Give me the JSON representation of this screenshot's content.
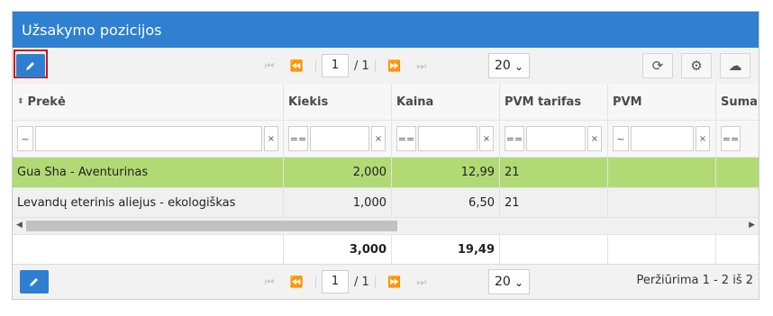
{
  "panel": {
    "title": "Užsakymo pozicijos"
  },
  "toolbar": {
    "edit_icon": "pencil-icon",
    "page_current": "1",
    "page_total": "/ 1",
    "page_size": "20",
    "refresh_icon": "refresh-icon",
    "settings_icon": "gear-icon",
    "download_icon": "cloud-download-icon"
  },
  "columns": [
    {
      "label": "Prekė",
      "sort_icon": "sort-icon"
    },
    {
      "label": "Kiekis"
    },
    {
      "label": "Kaina"
    },
    {
      "label": "PVM tarifas"
    },
    {
      "label": "PVM"
    },
    {
      "label": "Suma"
    }
  ],
  "filters": [
    "~",
    "==",
    "==",
    "==",
    "~",
    "=="
  ],
  "filter_clear": "×",
  "rows": [
    {
      "preke": "Gua Sha - Aventurinas",
      "kiekis": "2,000",
      "kaina": "12,99",
      "pvm_tarifas": "21",
      "pvm": "",
      "suma": ""
    },
    {
      "preke": "Levandų eterinis aliejus - ekologiškas",
      "kiekis": "1,000",
      "kaina": "6,50",
      "pvm_tarifas": "21",
      "pvm": "",
      "suma": ""
    }
  ],
  "totals": {
    "kiekis": "3,000",
    "kaina": "19,49"
  },
  "bottom": {
    "page_current": "1",
    "page_total": "/ 1",
    "page_size": "20",
    "status": "Peržiūrima 1 - 2 iš 2"
  },
  "colors": {
    "header": "#2f80d1",
    "selected_row": "#b1da74",
    "highlight_outline": "#d0121b"
  }
}
